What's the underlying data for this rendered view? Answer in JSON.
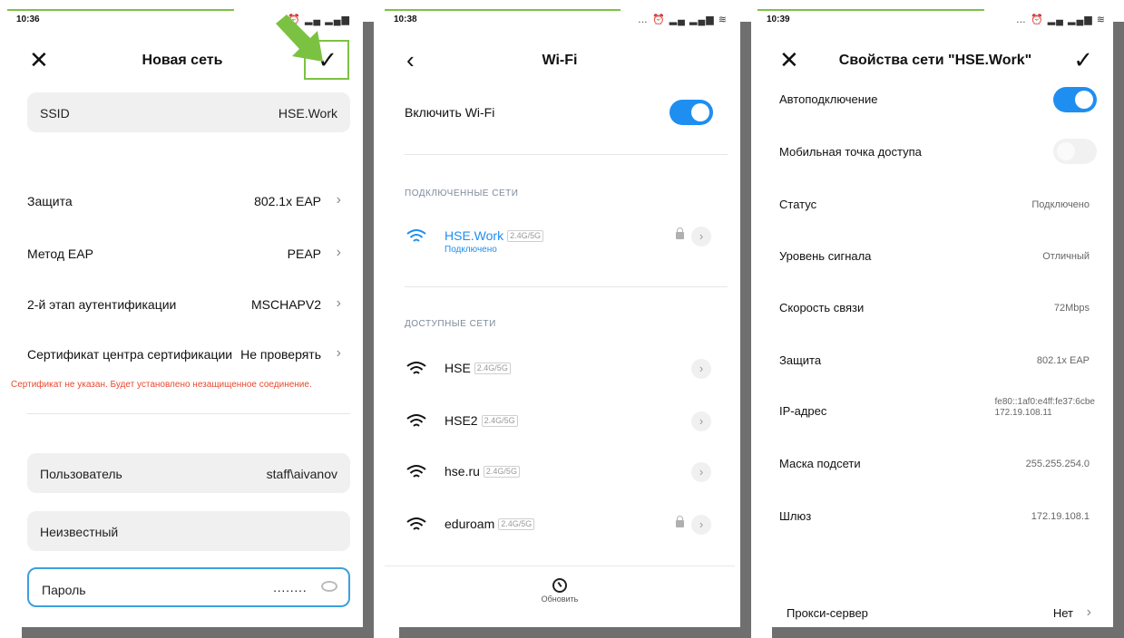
{
  "screen1": {
    "time": "10:36",
    "title": "Новая сеть",
    "ssid_label": "SSID",
    "ssid_value": "HSE.Work",
    "security_label": "Защита",
    "security_value": "802.1x EAP",
    "eap_label": "Метод EAP",
    "eap_value": "PEAP",
    "phase2_label": "2-й этап аутентификации",
    "phase2_value": "MSCHAPV2",
    "cert_label": "Сертификат центра сертификации",
    "cert_value": "Не проверять",
    "warning": "Сертификат не указан. Будет установлено незащищенное соединение.",
    "user_label": "Пользователь",
    "user_value": "staff\\aivanov",
    "anon_label": "Неизвестный",
    "password_label": "Пароль",
    "password_value": "········"
  },
  "screen2": {
    "time": "10:38",
    "title": "Wi-Fi",
    "enable_label": "Включить Wi-Fi",
    "connected_header": "ПОДКЛЮЧЕННЫЕ СЕТИ",
    "connected_network": {
      "name": "HSE.Work",
      "band": "2.4G/5G",
      "status": "Подключено"
    },
    "available_header": "ДОСТУПНЫЕ СЕТИ",
    "networks": [
      {
        "name": "HSE",
        "band": "2.4G/5G"
      },
      {
        "name": "HSE2",
        "band": "2.4G/5G"
      },
      {
        "name": "hse.ru",
        "band": "2.4G/5G"
      },
      {
        "name": "eduroam",
        "band": "2.4G/5G"
      }
    ],
    "refresh_label": "Обновить"
  },
  "screen3": {
    "time": "10:39",
    "title": "Свойства сети \"HSE.Work\"",
    "rows": {
      "auto_label": "Автоподключение",
      "hotspot_label": "Мобильная точка доступа",
      "status_label": "Статус",
      "status_value": "Подключено",
      "signal_label": "Уровень сигнала",
      "signal_value": "Отличный",
      "speed_label": "Скорость связи",
      "speed_value": "72Mbps",
      "security_label": "Защита",
      "security_value": "802.1x EAP",
      "ip_label": "IP-адрес",
      "ip_value_v6": "fe80::1af0:e4ff:fe37:6cbe",
      "ip_value_v4": "172.19.108.11",
      "mask_label": "Маска подсети",
      "mask_value": "255.255.254.0",
      "gateway_label": "Шлюз",
      "gateway_value": "172.19.108.1",
      "proxy_label": "Прокси-сервер",
      "proxy_value": "Нет"
    }
  },
  "colors": {
    "accent_blue": "#1f8ef1",
    "warning_red": "#e8492f",
    "highlight_green": "#7cc242"
  }
}
